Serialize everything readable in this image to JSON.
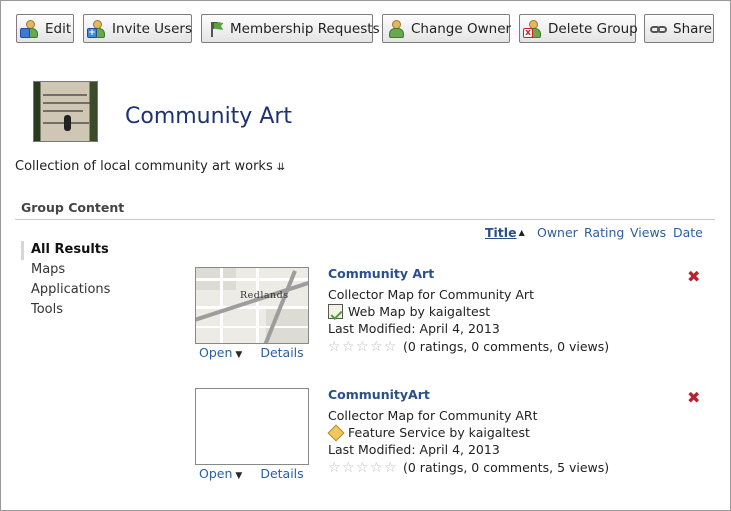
{
  "toolbar": {
    "edit": "Edit",
    "invite": "Invite Users",
    "requests": "Membership Requests",
    "owner": "Change Owner",
    "delete": "Delete Group",
    "share": "Share"
  },
  "group": {
    "title": "Community Art",
    "description": "Collection of local community art works",
    "desc_toggle": "⇊"
  },
  "section": {
    "title": "Group Content"
  },
  "sort": {
    "title": "Title",
    "title_arrow": "▲",
    "owner": "Owner",
    "rating": "Rating",
    "views": "Views",
    "date": "Date"
  },
  "filters": [
    "All Results",
    "Maps",
    "Applications",
    "Tools"
  ],
  "items": [
    {
      "title": "Community Art",
      "snippet": "Collector Map for Community Art",
      "type_line": "Web Map by kaigaltest",
      "modified": "Last Modified: April 4, 2013",
      "stats": "(0 ratings, 0 comments, 0 views)",
      "map_label": "Redlands",
      "open": "Open",
      "details": "Details"
    },
    {
      "title": "CommunityArt",
      "snippet": "Collector Map for Community ARt",
      "type_line": "Feature Service by kaigaltest",
      "modified": "Last Modified: April 4, 2013",
      "stats": "(0 ratings, 0 comments, 5 views)",
      "open": "Open",
      "details": "Details"
    }
  ],
  "icons": {
    "caret": "▼",
    "remove": "✖",
    "star": "☆"
  }
}
